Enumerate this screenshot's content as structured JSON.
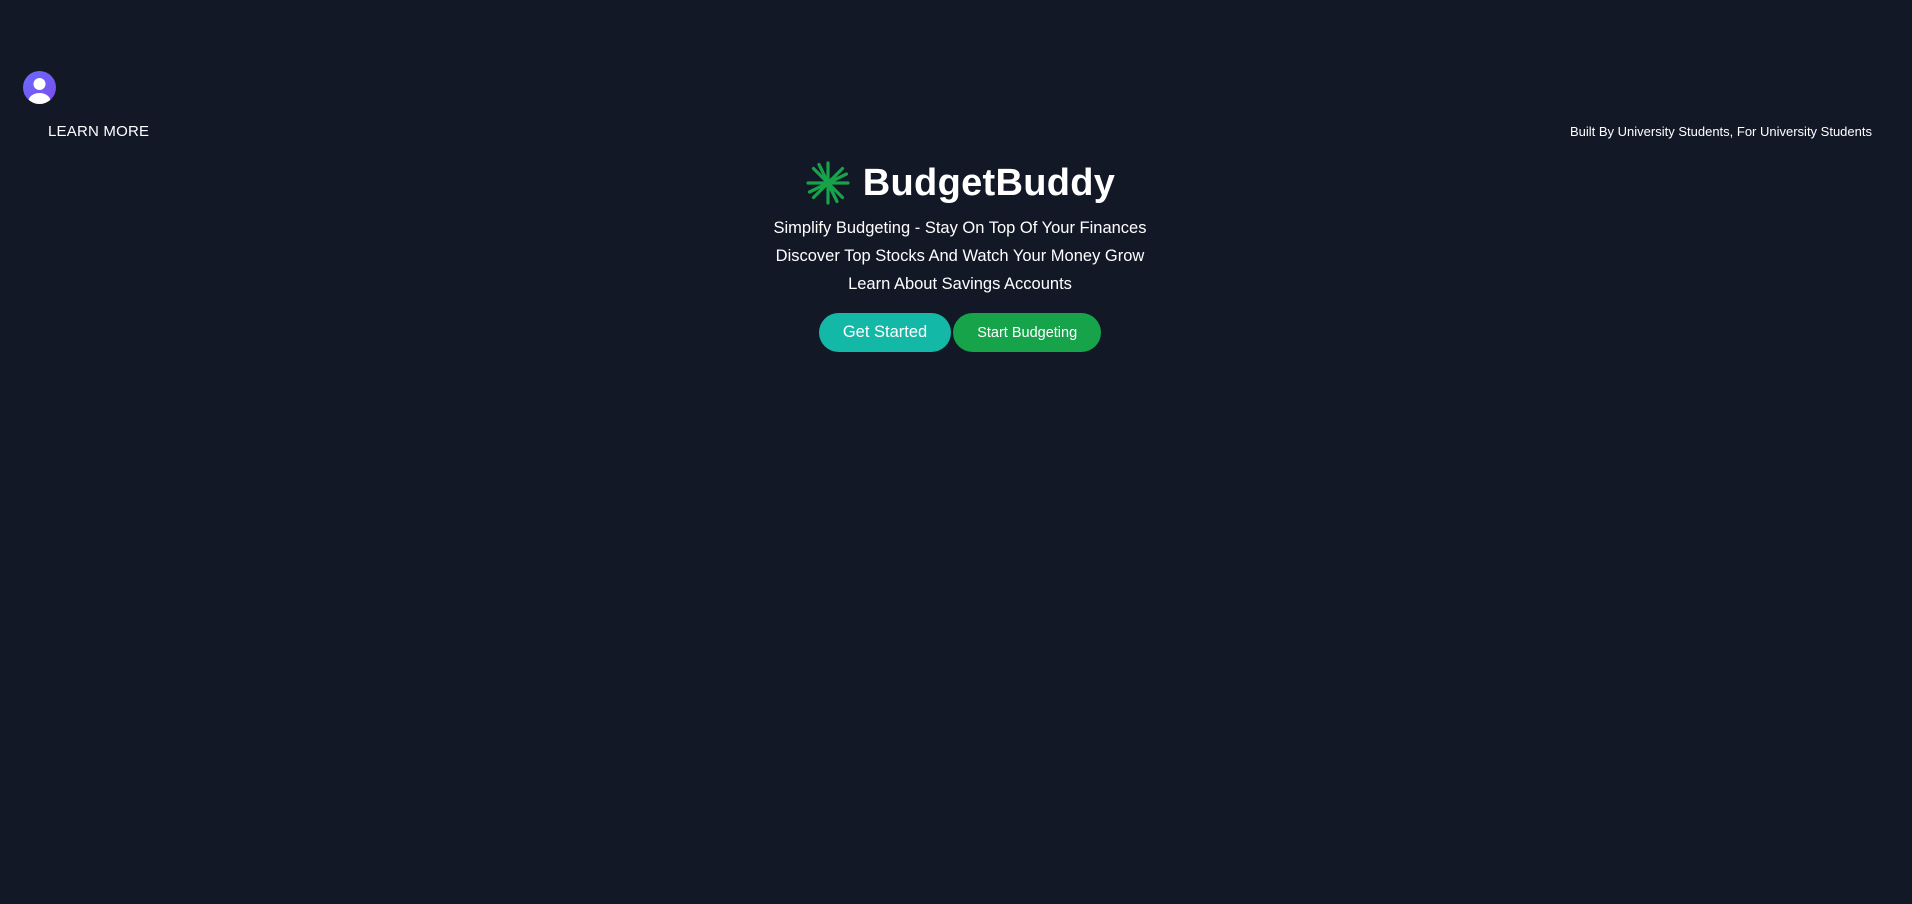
{
  "header": {
    "avatar_icon": "user-avatar-icon",
    "learn_more": "LEARN MORE",
    "tagline": "Built By University Students, For University Students"
  },
  "hero": {
    "logo_icon": "asterisk-logo-icon",
    "brand": "BudgetBuddy",
    "lines": [
      "Simplify Budgeting - Stay On Top Of Your Finances",
      "Discover Top Stocks And Watch Your Money Grow",
      "Learn About Savings Accounts"
    ],
    "get_started_label": "Get Started",
    "start_budgeting_label": "Start Budgeting"
  },
  "colors": {
    "background": "#131827",
    "logo_green": "#16a34a",
    "get_started": "#14b8a6",
    "start_budgeting": "#16a34a",
    "avatar": "#6b6bff"
  }
}
